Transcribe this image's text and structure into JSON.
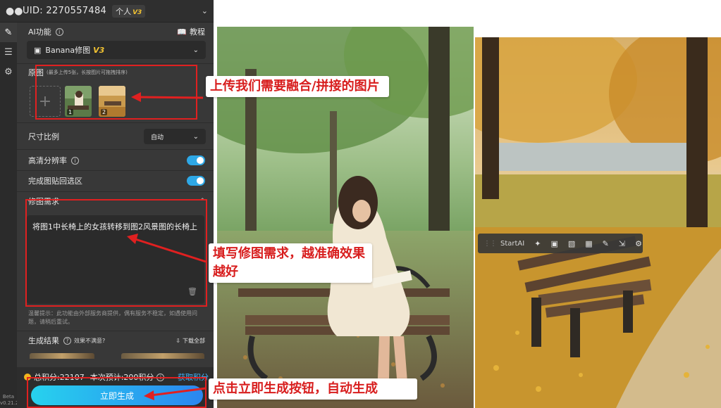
{
  "header": {
    "uid": "UID: 2270557484",
    "plan": "个人",
    "plan_level": "V3"
  },
  "toolbar": {
    "version": "Beta\nv0.21.2"
  },
  "panel": {
    "ai_function_label": "AI功能",
    "tutorial_label": "教程",
    "mode_select": "Banana修图",
    "mode_level": "V3",
    "source_label": "原图",
    "source_hint": "(最多上传5张，长按图片可拖拽排序)",
    "thumbs": [
      "1",
      "2"
    ],
    "ratio_label": "尺寸比例",
    "ratio_value": "自动",
    "hires_label": "高清分辨率",
    "paste_back_label": "完成图贴回选区",
    "edit_req_label": "修图需求",
    "edit_req_text": "将图1中长椅上的女孩转移到图2风景图的长椅上",
    "tip": "温馨提示：此功能由外部服务商提供，偶有服务不稳定，如遇使用问题，请稍后重试。",
    "results_label": "生成结果",
    "unsatisfied": "效果不满意?",
    "download_all": "下载全部"
  },
  "footer": {
    "total_credits": "总积分:22107",
    "estimate": "本次预计:200积分",
    "earn_link": "获取积分",
    "generate_button": "立即生成"
  },
  "annotations": {
    "upload": "上传我们需要融合/拼接的图片",
    "fill": "填写修图需求，越准确效果越好",
    "click": "点击立即生成按钮，自动生成"
  },
  "floating_toolbar": {
    "brand": "StartAI"
  },
  "colors": {
    "accent": "#2ea8e6",
    "annotation_red": "#e02020",
    "link_blue": "#3fb5ff",
    "coin_gold": "#f2b51e"
  },
  "icons": {
    "header": "users-icon",
    "strip": [
      "pencil-icon",
      "layers-icon",
      "gear-icon"
    ],
    "float_toolbar": [
      "magic-wand-icon",
      "image-edit-icon",
      "texture-icon",
      "crop-icon",
      "brush-icon",
      "resize-icon",
      "settings-icon"
    ]
  }
}
